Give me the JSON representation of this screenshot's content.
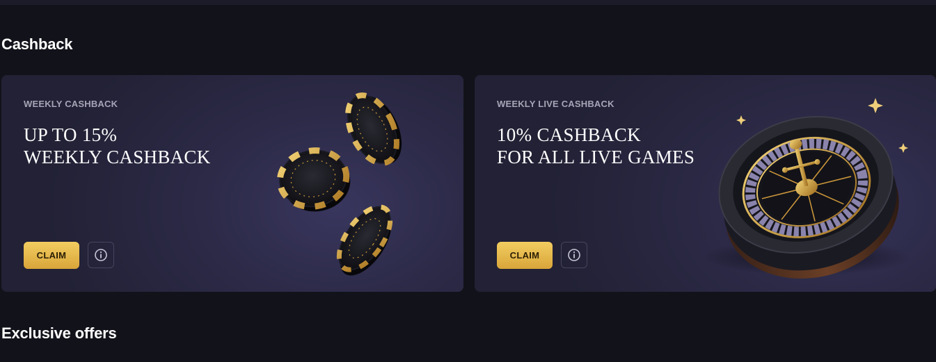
{
  "sections": {
    "cashback_title": "Cashback",
    "exclusive_title": "Exclusive offers"
  },
  "cards": [
    {
      "eyebrow": "WEEKLY CASHBACK",
      "headline_line1": "UP TO 15%",
      "headline_line2": "WEEKLY CASHBACK",
      "claim_label": "CLAIM",
      "info_icon": "info-icon",
      "art": "casino-chips-illustration"
    },
    {
      "eyebrow": "WEEKLY LIVE CASHBACK",
      "headline_line1": "10% CASHBACK",
      "headline_line2": "FOR ALL LIVE GAMES",
      "claim_label": "CLAIM",
      "info_icon": "info-icon",
      "art": "roulette-wheel-illustration"
    }
  ],
  "colors": {
    "page_bg": "#12121a",
    "card_bg": "#2c2a47",
    "accent_gold": "#e3b54a",
    "eyebrow_text": "#a6a5b8"
  }
}
